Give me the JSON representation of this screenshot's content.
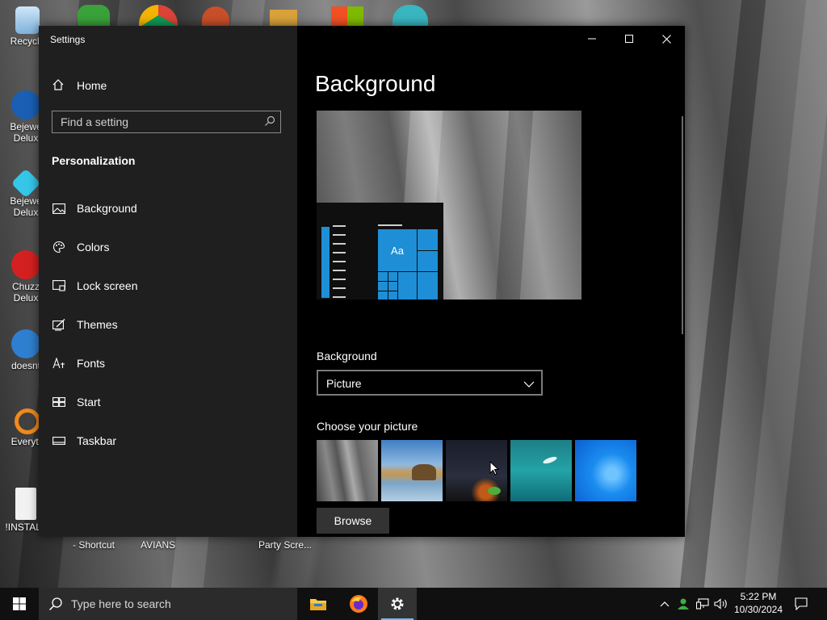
{
  "desktop": {
    "labels": [
      "Recycle",
      "Bejewe\nDelux",
      "Bejewe\nDelux",
      "Chuzz\nDelux",
      "doesnt",
      "Everyth",
      "!INSTALL",
      "- Shortcut",
      "AVIANS",
      "Party Scre..."
    ]
  },
  "window": {
    "title": "Settings",
    "minimize_glyph": "—",
    "maximize_glyph": "☐",
    "close_glyph": "✕"
  },
  "nav": {
    "home_label": "Home",
    "search_placeholder": "Find a setting",
    "section_title": "Personalization",
    "items": [
      {
        "label": "Background",
        "icon": "picture-icon"
      },
      {
        "label": "Colors",
        "icon": "palette-icon"
      },
      {
        "label": "Lock screen",
        "icon": "lock-screen-icon"
      },
      {
        "label": "Themes",
        "icon": "themes-icon"
      },
      {
        "label": "Fonts",
        "icon": "fonts-icon"
      },
      {
        "label": "Start",
        "icon": "start-icon"
      },
      {
        "label": "Taskbar",
        "icon": "taskbar-icon"
      }
    ]
  },
  "content": {
    "page_title": "Background",
    "preview_tile_text": "Aa",
    "background_label": "Background",
    "background_value": "Picture",
    "choose_label": "Choose your picture",
    "browse_label": "Browse"
  },
  "taskbar": {
    "search_text": "Type here to search",
    "time": "5:22 PM",
    "date": "10/30/2024"
  },
  "colors": {
    "accent": "#1e8fd6",
    "nav_bg": "#1f1f1f",
    "content_bg": "#000000",
    "taskbar_bg": "#101010"
  }
}
